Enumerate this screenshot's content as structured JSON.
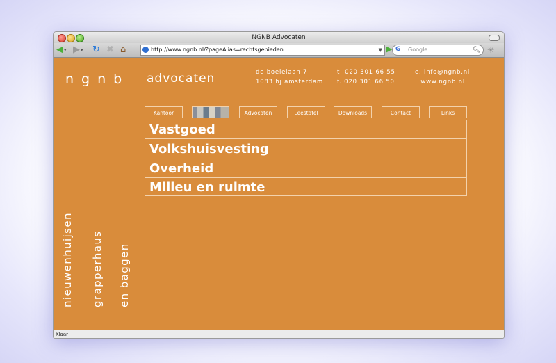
{
  "browser": {
    "title": "NGNB Advocaten",
    "url": "http://www.ngnb.nl/?pageAlias=rechtsgebieden",
    "search_placeholder": "Google",
    "status": "Klaar"
  },
  "site": {
    "logo_letters": "ngnb",
    "logo_text": "advocaten",
    "address_line1": "de boelelaan 7",
    "address_line2": "1083 hj amsterdam",
    "phone": "t. 020 301 66 55",
    "fax": "f. 020 301 66 50",
    "email": "e. info@ngnb.nl",
    "web": "www.ngnb.nl",
    "vertical_names": [
      "nieuwenhuijsen",
      "grapperhaus",
      "en baggen"
    ]
  },
  "nav": {
    "tabs": [
      "Kantoor",
      "Advocaten",
      "Leestafel",
      "Downloads",
      "Contact",
      "Links"
    ]
  },
  "practice_areas": [
    "Vastgoed",
    "Volkshuisvesting",
    "Overheid",
    "Milieu en ruimte"
  ],
  "colors": {
    "background": "#d98c3b",
    "text": "#ffffff",
    "border": "#f3d2ac"
  },
  "icons": [
    "back-arrow-icon",
    "forward-arrow-icon",
    "reload-icon",
    "stop-icon",
    "home-icon",
    "site-icon",
    "google-icon",
    "search-icon"
  ]
}
